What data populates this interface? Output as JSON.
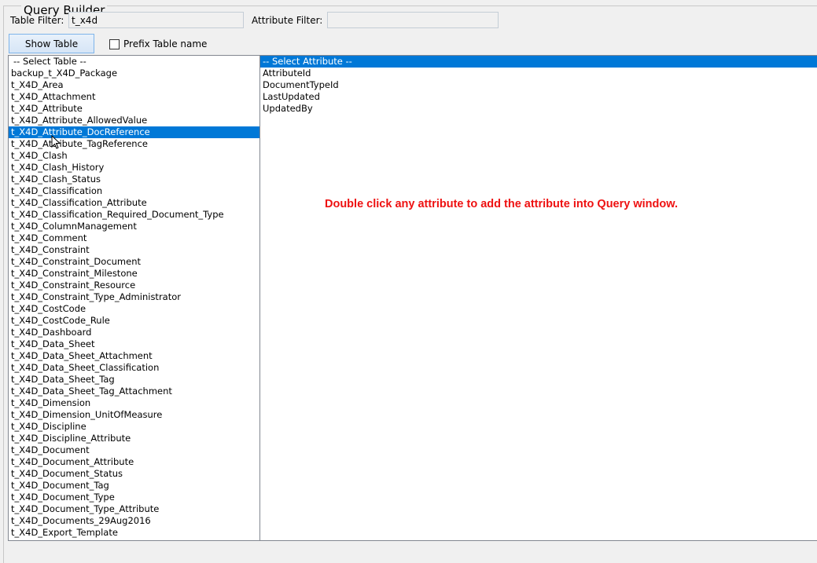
{
  "group_title": "Query Builder",
  "table_filter": {
    "label": "Table Filter:",
    "value": "t_x4d"
  },
  "attribute_filter": {
    "label": "Attribute Filter:",
    "value": ""
  },
  "show_table_button": "Show Table",
  "prefix_checkbox": {
    "label": "Prefix Table name",
    "checked": false
  },
  "tables": {
    "selected_index": 6,
    "items": [
      "-- Select Table --",
      "backup_t_X4D_Package",
      "t_X4D_Area",
      "t_X4D_Attachment",
      "t_X4D_Attribute",
      "t_X4D_Attribute_AllowedValue",
      "t_X4D_Attribute_DocReference",
      "t_X4D_Attribute_TagReference",
      "t_X4D_Clash",
      "t_X4D_Clash_History",
      "t_X4D_Clash_Status",
      "t_X4D_Classification",
      "t_X4D_Classification_Attribute",
      "t_X4D_Classification_Required_Document_Type",
      "t_X4D_ColumnManagement",
      "t_X4D_Comment",
      "t_X4D_Constraint",
      "t_X4D_Constraint_Document",
      "t_X4D_Constraint_Milestone",
      "t_X4D_Constraint_Resource",
      "t_X4D_Constraint_Type_Administrator",
      "t_X4D_CostCode",
      "t_X4D_CostCode_Rule",
      "t_X4D_Dashboard",
      "t_X4D_Data_Sheet",
      "t_X4D_Data_Sheet_Attachment",
      "t_X4D_Data_Sheet_Classification",
      "t_X4D_Data_Sheet_Tag",
      "t_X4D_Data_Sheet_Tag_Attachment",
      "t_X4D_Dimension",
      "t_X4D_Dimension_UnitOfMeasure",
      "t_X4D_Discipline",
      "t_X4D_Discipline_Attribute",
      "t_X4D_Document",
      "t_X4D_Document_Attribute",
      "t_X4D_Document_Status",
      "t_X4D_Document_Tag",
      "t_X4D_Document_Type",
      "t_X4D_Document_Type_Attribute",
      "t_X4D_Documents_29Aug2016",
      "t_X4D_Export_Template"
    ]
  },
  "attributes": {
    "selected_index": 0,
    "items": [
      "-- Select Attribute --",
      "AttributeId",
      "DocumentTypeId",
      "LastUpdated",
      "UpdatedBy"
    ]
  },
  "hint_text": "Double click any attribute to add the attribute into Query window.",
  "colors": {
    "selection": "#0078d7",
    "hint": "#ee1111"
  }
}
